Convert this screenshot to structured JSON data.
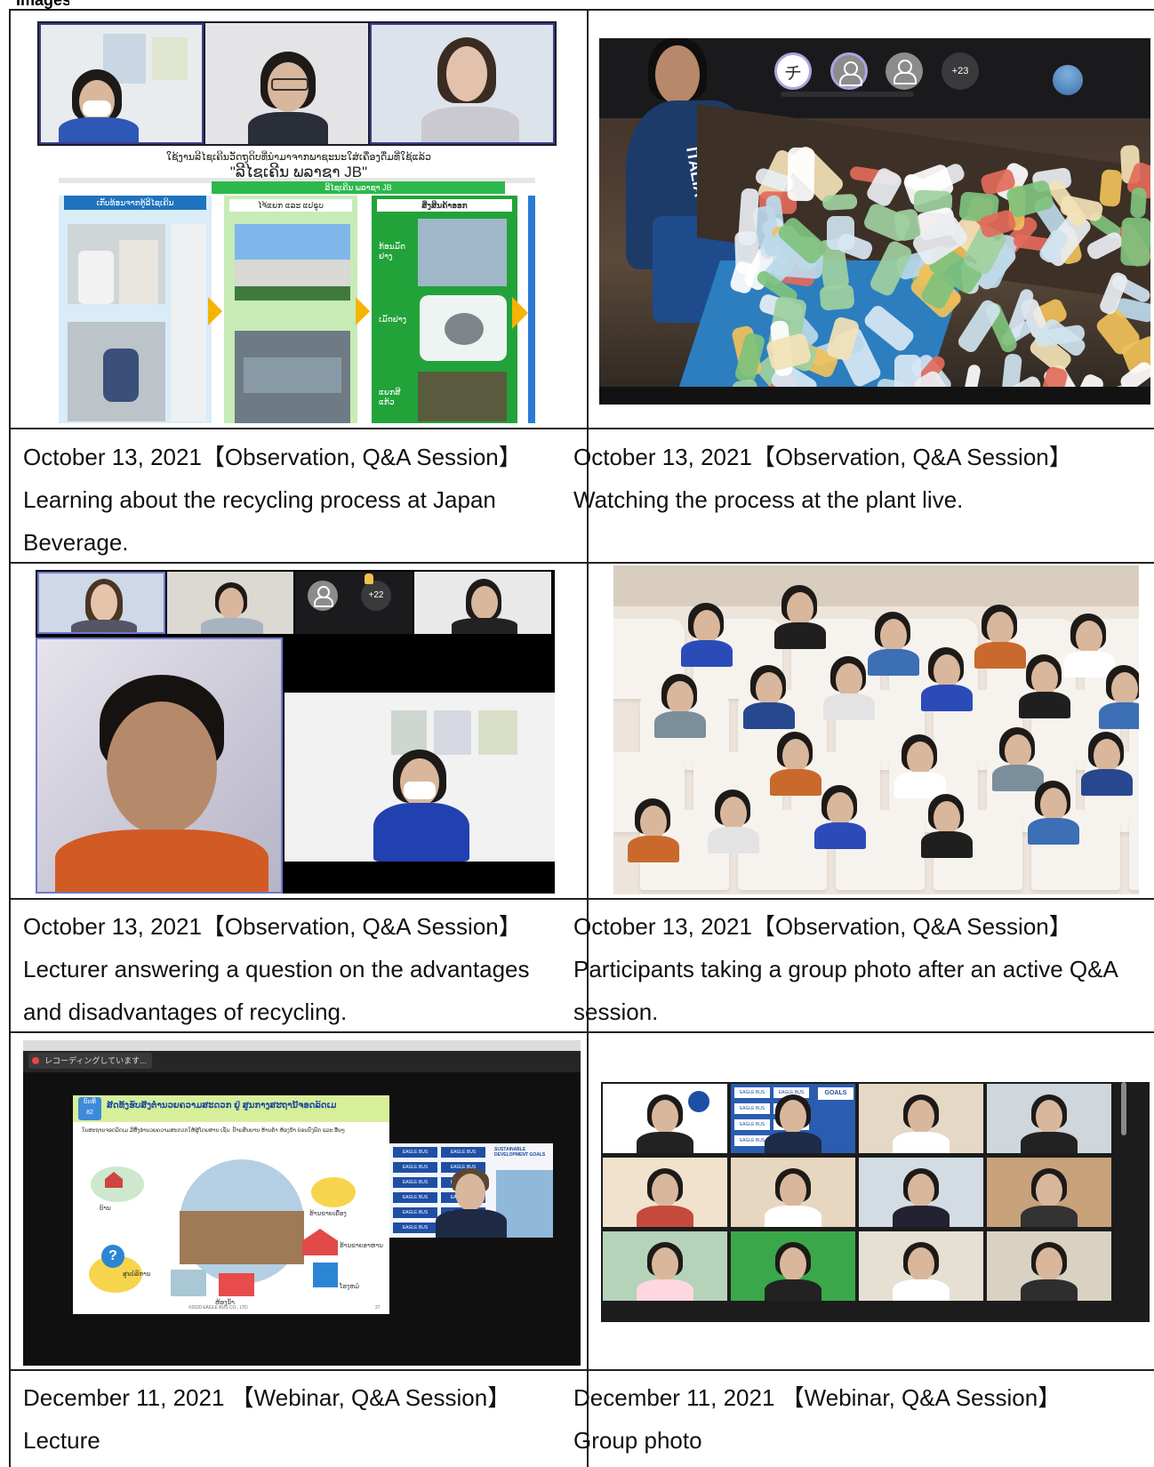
{
  "header_fragment": "Images",
  "cells": [
    {
      "photo_label": "Lao-language recycling slide with video call participants",
      "caption": "October 13, 2021【Observation, Q&A Session】Learning about the recycling process at Japan Beverage.",
      "slide_text": {
        "title_line1": "ໃຊ້ງານລີໄຊເຄີນວັດຖຸດິບທີ່ນຳມາຈາກພາຊະນະໃສ່ເຄື່ອງດື່ມທີ່ໃຊ້ແລ້ວ",
        "title_line2": "\"ລີໄຊເຄີນ ພລາຊາ JB\"",
        "header": "ລີໄຊເຄີນ ພລາຊາ JB",
        "col1": "ເກັບທ້ອນຈາກຕູ້ລີໄຊເຄີນ",
        "col2": "ໄຈ້ແຍກ ແລະ ແປຣູບ",
        "col3": "ສິ່ງສິນຄ້າອອກ",
        "lbl_a": "ກ້ອນມັດ ຢາງ",
        "lbl_b": "ເມັດຢາງ",
        "lbl_c": "ແຍກສີ ແກ້ວ"
      }
    },
    {
      "photo_label": "Live video of plastic bottles on conveyor",
      "caption": "October 13, 2021【Observation, Q&A Session】Watching the process at the plant live.",
      "avatar_initial": "チ",
      "extra_count": "+23",
      "shirt_text": "ITALIA"
    },
    {
      "photo_label": "Video call with lecturer answering question",
      "caption": "October 13, 2021【Observation, Q&A Session】Lecturer answering a question on the advantages and disadvantages of recycling.",
      "extra_count": "+22"
    },
    {
      "photo_label": "Group photo of participants with virtual auditorium background",
      "caption": "October 13, 2021【Observation, Q&A Session】Participants taking a group photo after an active Q&A session."
    },
    {
      "photo_label": "Webinar lecture slide with presenter",
      "caption": "December 11, 2021 【Webinar, Q&A Session】Lecture",
      "recording_text": "レコーディングしています...",
      "slide_title": "ສິດທິ້ງຮັບສິ່ງຕໍ່ານວຍຄວາມສະດວກ ຢູ່ ສູນກາງສະຖານີ້ຈອດລົດເມ",
      "badge_top": "ບົດທີ",
      "badge_bottom": "82",
      "slide_body": "ໃນສະຖານຈອດລົດເມ ມີສິ່ງອຳນວຍຄວາມສະດວກໃຫ້ຜູ້ໂດຍສານ ເຊັ່ນ: ປ້າຍສັນຍານ ຮ້ານຄ້າ ຫ້ອງນ້ຳ ບ່ອນນັ່ງພັກ ແລະ ອື່ນໆ",
      "slide_labels": [
        "ບ້ານ",
        "ຮ້ານຂາຍເຄື່ອງ",
        "ໂຮງຫມໍ",
        "ສູນບໍລິການ",
        "ຮ້ານຂາຍອາຫານ",
        "ຫ້ອງນ້ຳ"
      ],
      "slide_footer": "©2020 EAGLE BUS CO., LTD",
      "slide_page": "27",
      "backdrop_brand": "EAGLE BUS",
      "sdg_text": "SUSTAINABLE DEVELOPMENT GOALS"
    },
    {
      "photo_label": "Group photo grid of webinar participants",
      "caption": "December 11, 2021 【Webinar, Q&A Session】Group photo",
      "backdrop_brand": "EAGLE BUS",
      "sdg_text": "GOALS"
    }
  ]
}
